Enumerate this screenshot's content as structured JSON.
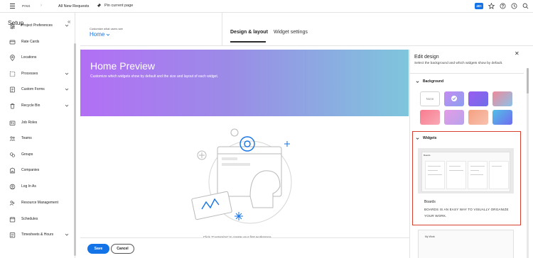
{
  "topbar": {
    "app_name": "PINS",
    "breadcrumb": "All New Requests",
    "pin_label": "Pin current page",
    "badge": "40+"
  },
  "sidebar": {
    "title": "Setup",
    "items": [
      {
        "label": "Project Preferences",
        "icon": "sliders-icon",
        "chevron": true
      },
      {
        "label": "Rate Cards",
        "icon": "card-icon",
        "chevron": false
      },
      {
        "label": "Locations",
        "icon": "location-pin-icon",
        "chevron": false
      },
      {
        "label": "Processes",
        "icon": "process-icon",
        "chevron": true
      },
      {
        "label": "Custom Forms",
        "icon": "form-icon",
        "chevron": true
      },
      {
        "label": "Recycle Bin",
        "icon": "trash-icon",
        "chevron": true
      },
      {
        "label": "Job Roles",
        "icon": "badge-icon",
        "chevron": false
      },
      {
        "label": "Teams",
        "icon": "team-icon",
        "chevron": false
      },
      {
        "label": "Groups",
        "icon": "groups-icon",
        "chevron": false
      },
      {
        "label": "Companies",
        "icon": "company-icon",
        "chevron": false
      },
      {
        "label": "Log In As",
        "icon": "login-icon",
        "chevron": false
      },
      {
        "label": "Resource Management",
        "icon": "resource-icon",
        "chevron": false
      },
      {
        "label": "Schedules",
        "icon": "calendar-icon",
        "chevron": false
      },
      {
        "label": "Timesheets & Hours",
        "icon": "timesheet-icon",
        "chevron": true
      }
    ]
  },
  "header": {
    "caption": "Customize what users see",
    "selected": "Home",
    "tabs": [
      {
        "label": "Design & layout",
        "active": true
      },
      {
        "label": "Widget settings",
        "active": false
      }
    ]
  },
  "preview": {
    "title": "Home Preview",
    "subtitle": "Customize which widgets show by default and the size and layout of each widget.",
    "caption": "Click \"Customize\" to create your first workspace"
  },
  "footer": {
    "save": "Save",
    "cancel": "Cancel"
  },
  "panel": {
    "title": "Edit design",
    "subtitle": "Select the background and which widgets show by default.",
    "background_heading": "Background",
    "none_label": "None",
    "swatches": [
      {
        "fill": "none",
        "selected": false
      },
      {
        "fill": "linear-gradient(135deg,#c58cf2,#8a9ff0)",
        "selected": true
      },
      {
        "fill": "linear-gradient(135deg,#9b5cf0,#6d6ee8)",
        "selected": false
      },
      {
        "fill": "linear-gradient(135deg,#f08a9a,#8bc2e8)",
        "selected": false
      },
      {
        "fill": "linear-gradient(135deg,#f77b8f,#f9a9b5)",
        "selected": false
      },
      {
        "fill": "linear-gradient(135deg,#e59be6,#b7a3ec)",
        "selected": false
      },
      {
        "fill": "linear-gradient(135deg,#f6a080,#f7c2b0)",
        "selected": false
      },
      {
        "fill": "linear-gradient(135deg,#51c0e6,#6f6cf0)",
        "selected": false
      }
    ],
    "widgets_heading": "Widgets",
    "widget": {
      "thumb_label": "Boards",
      "name": "Boards",
      "description": "BOARDS IS AN EASY WAY TO VISUALLY ORGANIZE YOUR WORK."
    },
    "next_widget_label": "My Work"
  },
  "colors": {
    "accent": "#1473e6",
    "highlight": "#d8412f"
  }
}
